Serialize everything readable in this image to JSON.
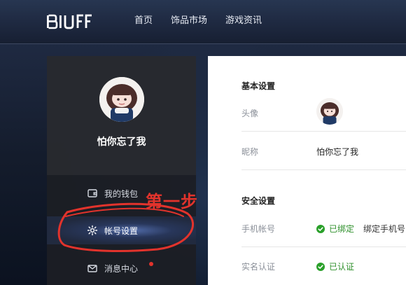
{
  "header": {
    "logo_text": "BUFF",
    "nav": [
      "首页",
      "饰品市场",
      "游戏资讯"
    ]
  },
  "sidebar": {
    "username": "怕你忘了我",
    "items": [
      {
        "label": "我的钱包",
        "icon": "wallet-icon"
      },
      {
        "label": "帐号设置",
        "icon": "gear-icon",
        "active": true
      },
      {
        "label": "消息中心",
        "icon": "mail-icon",
        "has_notification_dot": true
      }
    ]
  },
  "main": {
    "basic_settings": {
      "title": "基本设置",
      "avatar_label": "头像",
      "nickname_label": "昵称",
      "nickname_value": "怕你忘了我"
    },
    "security_settings": {
      "title": "安全设置",
      "phone_label": "手机帐号",
      "phone_status": "已绑定",
      "phone_action": "绑定手机号",
      "realname_label": "实名认证",
      "realname_status": "已认证"
    }
  },
  "annotation": {
    "text": "第一步",
    "color": "#e2332c"
  },
  "colors": {
    "success": "#2aa02a",
    "notification": "#e2332c"
  }
}
